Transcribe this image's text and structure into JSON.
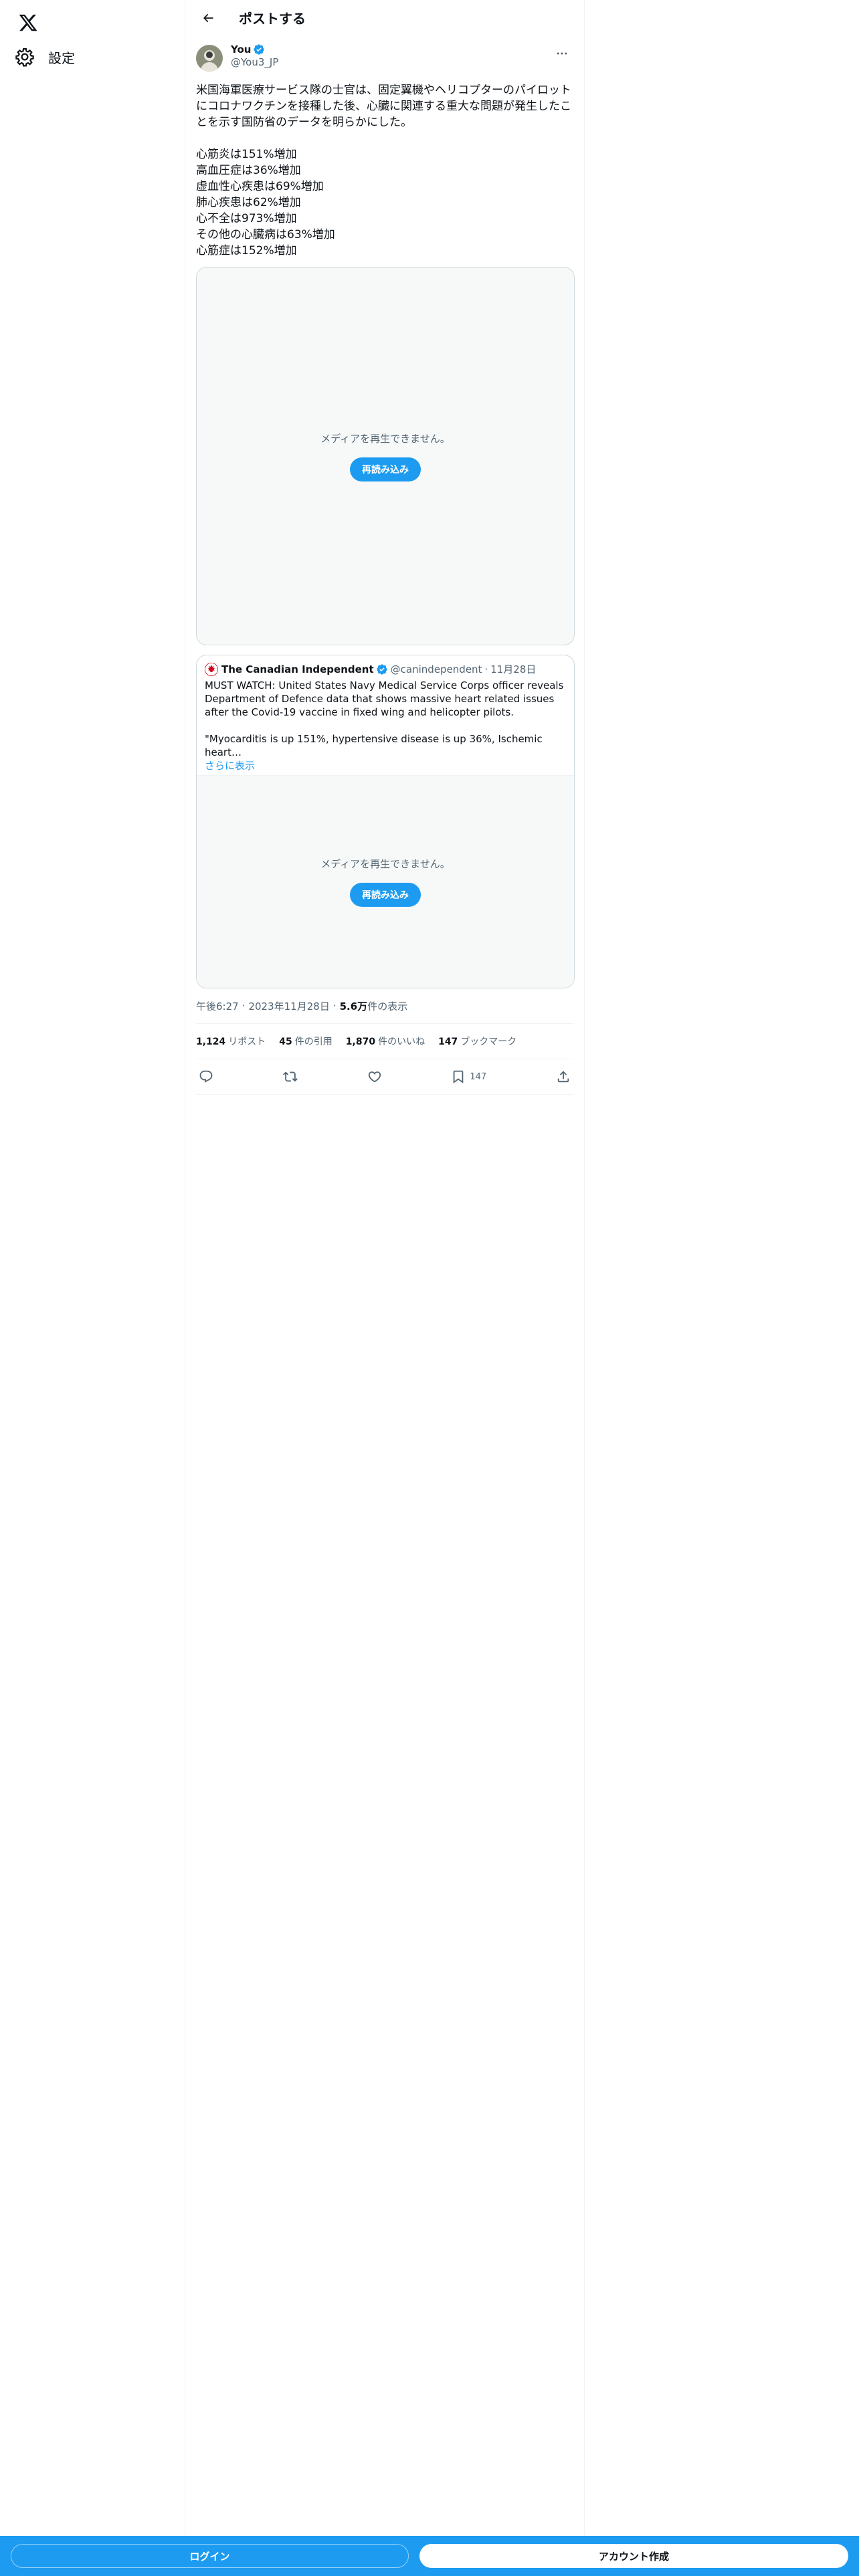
{
  "nav": {
    "settings_label": "設定"
  },
  "header": {
    "title": "ポストする"
  },
  "post": {
    "author_name": "You",
    "author_handle": "@You3_JP",
    "text": "米国海軍医療サービス隊の士官は、固定翼機やヘリコプターのパイロットにコロナワクチンを接種した後、心臓に関連する重大な問題が発生したことを示す国防省のデータを明らかにした。\n\n心筋炎は151%増加\n高血圧症は36%増加\n虚血性心疾患は69%増加\n肺心疾患は62%増加\n心不全は973%増加\nその他の心臓病は63%増加\n心筋症は152%増加",
    "media_message": "メディアを再生できません。",
    "reload_label": "再読み込み",
    "time": "午後6:27",
    "date": "2023年11月28日",
    "views_num": "5.6万",
    "views_label": "件の表示"
  },
  "quote": {
    "name": "The Canadian Independent",
    "handle": "@canindependent",
    "date": "11月28日",
    "text": "MUST WATCH: United States Navy Medical Service Corps officer reveals Department of Defence data that shows massive heart related issues after the Covid-19 vaccine in fixed wing and helicopter pilots.\n\n\"Myocarditis is up 151%, hypertensive disease is up 36%, Ischemic heart…",
    "show_more": "さらに表示",
    "media_message": "メディアを再生できません。",
    "reload_label": "再読み込み"
  },
  "stats": {
    "reposts_num": "1,124",
    "reposts_label": "リポスト",
    "quotes_num": "45",
    "quotes_label": "件の引用",
    "likes_num": "1,870",
    "likes_label": "件のいいね",
    "bookmarks_num": "147",
    "bookmarks_label": "ブックマーク"
  },
  "actions": {
    "bookmark_count": "147"
  },
  "bottom_bar": {
    "login_label": "ログイン",
    "signup_label": "アカウント作成"
  },
  "colors": {
    "accent": "#1d9bf0",
    "text_primary": "#0f1419",
    "text_secondary": "#536471"
  }
}
